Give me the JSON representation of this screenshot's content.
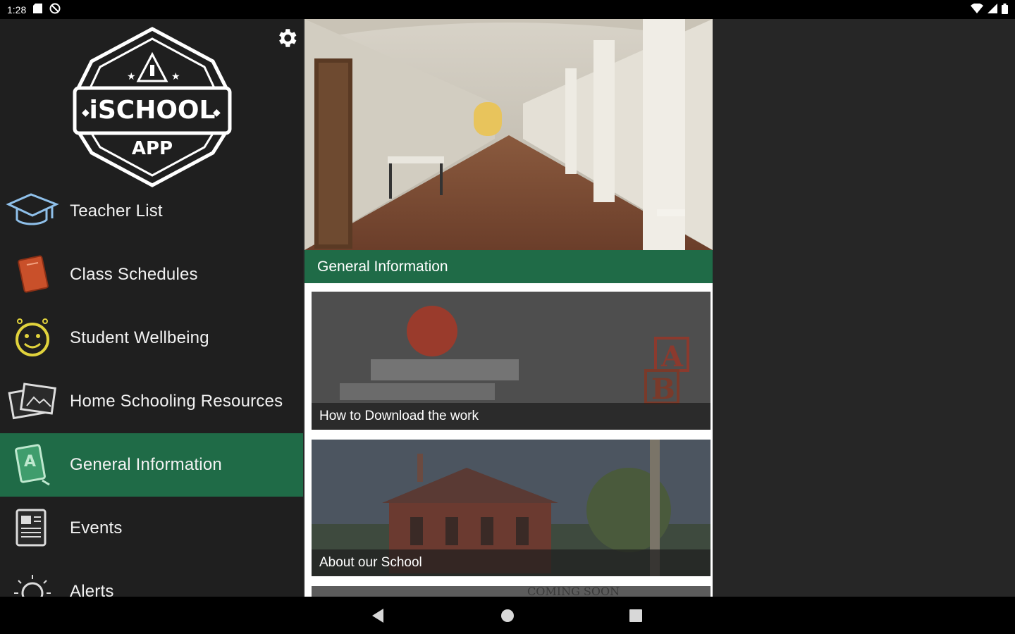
{
  "status_bar": {
    "time": "1:28",
    "left_icons": [
      "sd-card-icon",
      "no-sim-icon"
    ],
    "right_icons": [
      "wifi-icon",
      "signal-icon",
      "battery-icon"
    ]
  },
  "drawer": {
    "logo": {
      "main_text": "iSCHOOL",
      "sub_text": "APP"
    },
    "settings_icon": "gear-icon",
    "menu": [
      {
        "label": "Teacher List",
        "icon": "graduation-cap-icon",
        "active": false
      },
      {
        "label": "Class Schedules",
        "icon": "notebook-icon",
        "active": false
      },
      {
        "label": "Student Wellbeing",
        "icon": "smiley-clock-icon",
        "active": false
      },
      {
        "label": "Home Schooling Resources",
        "icon": "photos-icon",
        "active": false
      },
      {
        "label": "General Information",
        "icon": "book-icon",
        "active": true
      },
      {
        "label": "Events",
        "icon": "newspaper-icon",
        "active": false
      },
      {
        "label": "Alerts",
        "icon": "lightbulb-icon",
        "active": false,
        "badge": "!"
      }
    ]
  },
  "main": {
    "section_title": "General Information",
    "cards": [
      {
        "caption": "How to Download the work"
      },
      {
        "caption": "About our School"
      },
      {
        "caption": ""
      }
    ],
    "partial_card_text": "COMING SOON"
  },
  "colors": {
    "accent_green": "#1f6b47",
    "drawer_bg": "#1f1f1f",
    "alert_red": "#d9302a"
  },
  "nav_bar": {
    "buttons": [
      "back-icon",
      "home-icon",
      "recents-icon"
    ]
  }
}
